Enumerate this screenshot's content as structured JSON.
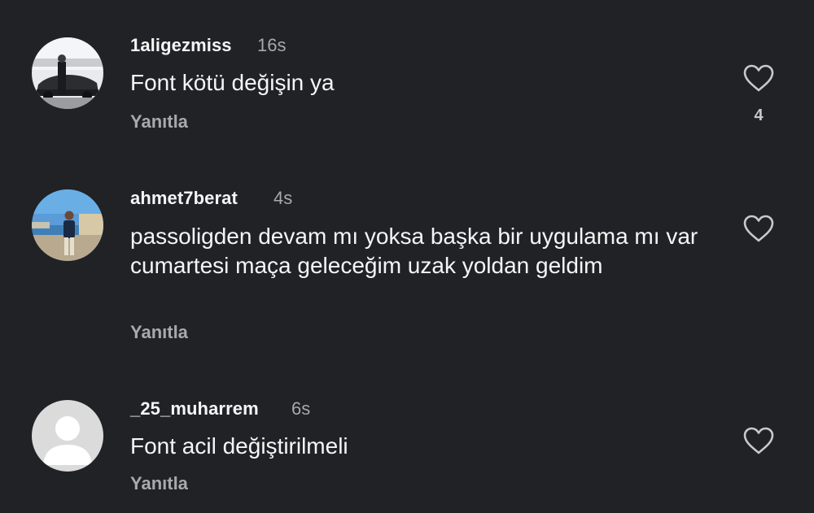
{
  "colors": {
    "background": "#212226",
    "primary_text": "#f5f5f5",
    "secondary_text": "#a8a8ad"
  },
  "comments": [
    {
      "username": "1aligezmiss",
      "time": "16s",
      "text": "Font kötü değişin ya",
      "reply_label": "Yanıtla",
      "like_icon": "heart-outline-icon",
      "like_count": "4"
    },
    {
      "username": "ahmet7berat",
      "time": "4s",
      "text": "passoligden devam mı yoksa başka bir uygulama mı var cumartesi maça geleceğim uzak yoldan geldim",
      "reply_label": "Yanıtla",
      "like_icon": "heart-outline-icon"
    },
    {
      "username": "_25_muharrem",
      "time": "6s",
      "text": "Font acil değiştirilmeli",
      "reply_label": "Yanıtla",
      "like_icon": "heart-outline-icon"
    }
  ]
}
